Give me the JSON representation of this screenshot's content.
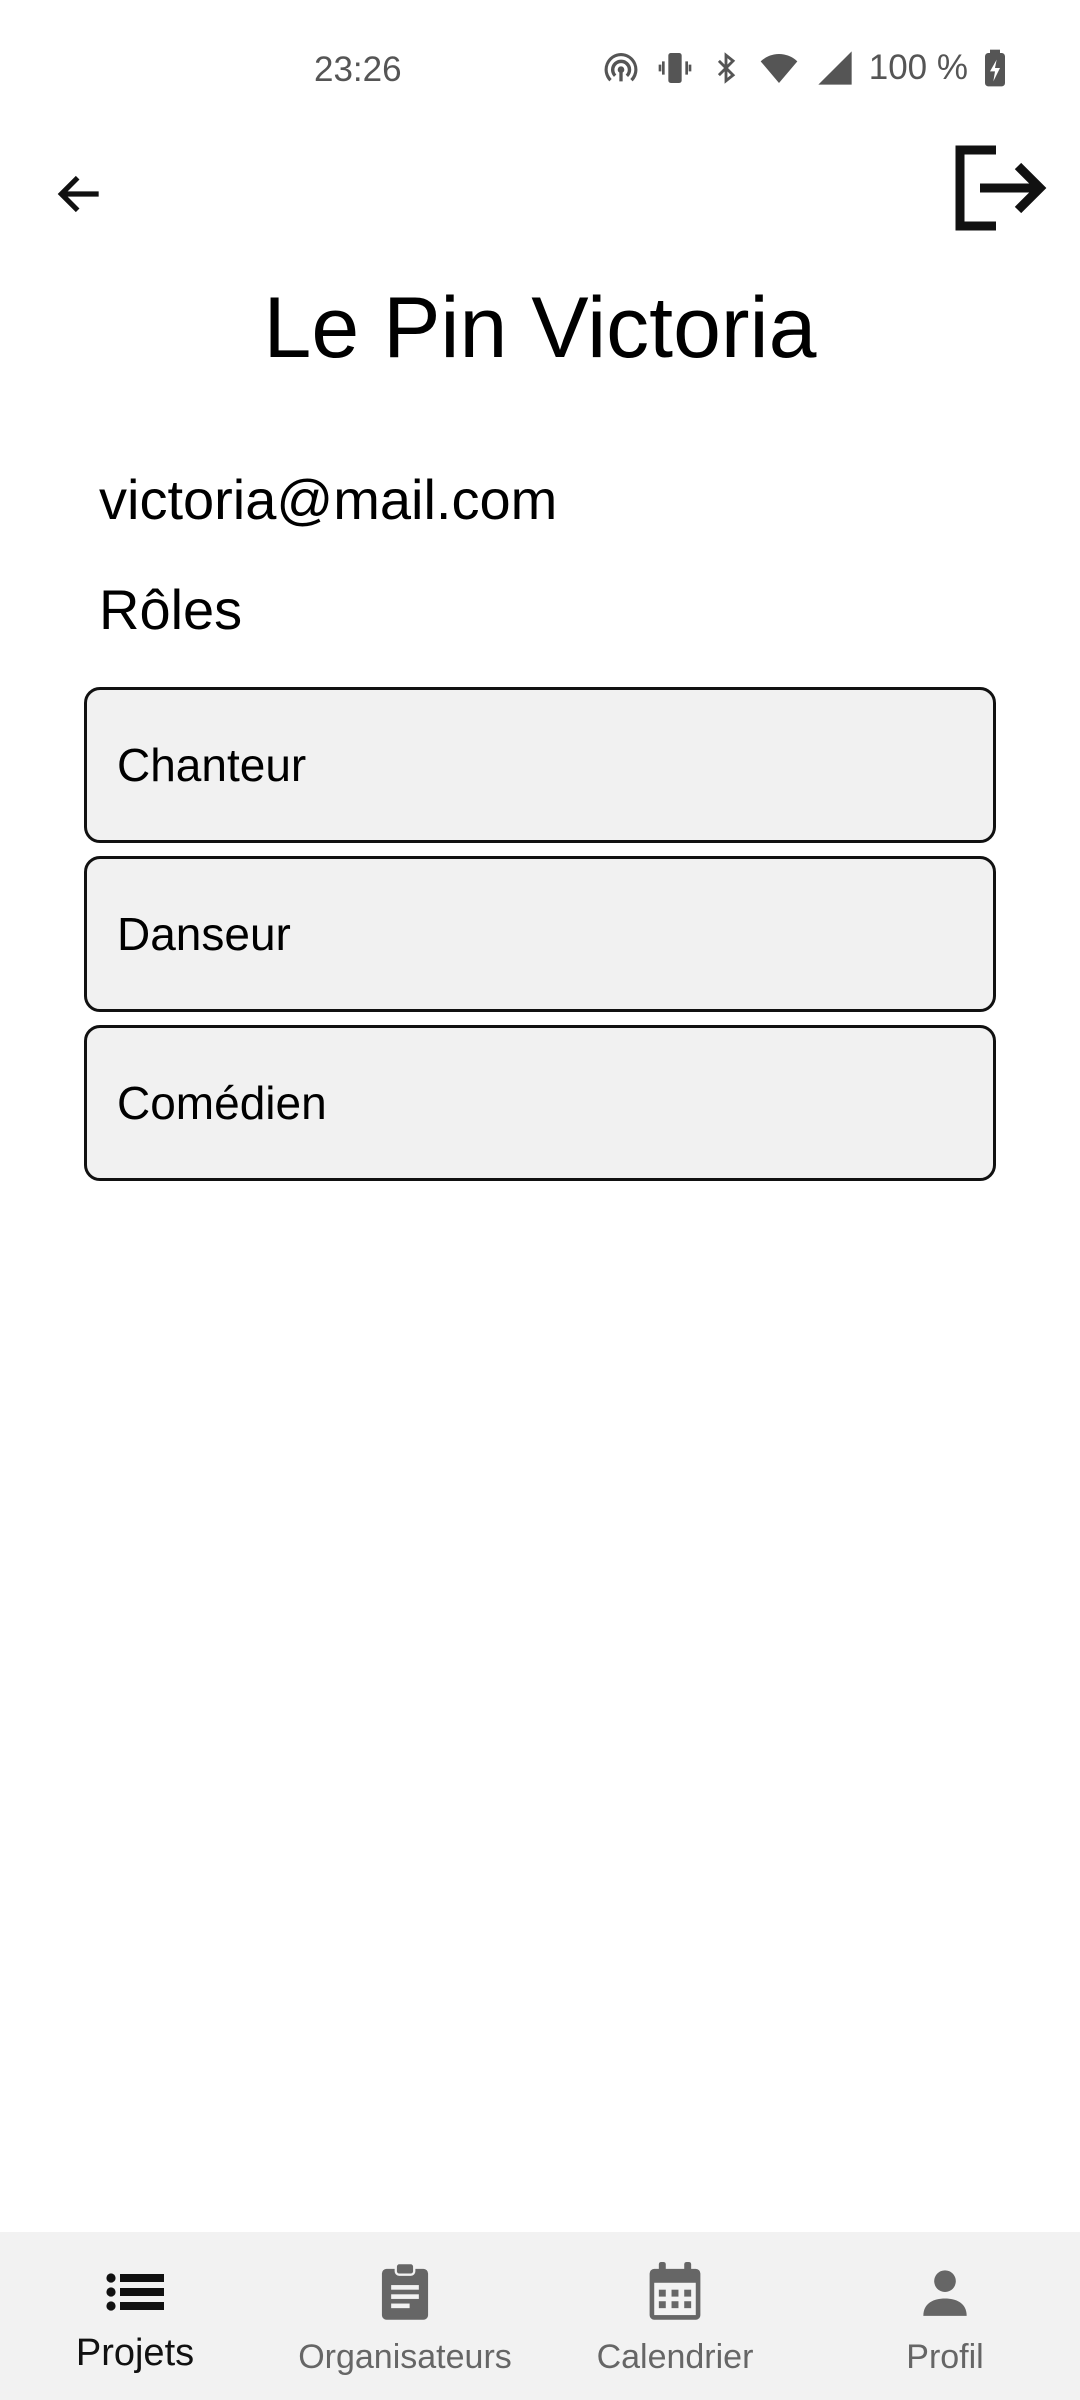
{
  "status_bar": {
    "time": "23:26",
    "battery": "100 %"
  },
  "profile": {
    "name": "Le Pin Victoria",
    "email": "victoria@mail.com",
    "roles_heading": "Rôles",
    "roles": [
      "Chanteur",
      "Danseur",
      "Comédien"
    ]
  },
  "bottom_nav": {
    "items": [
      {
        "label": "Projets",
        "icon": "list-icon",
        "active": true
      },
      {
        "label": "Organisateurs",
        "icon": "clipboard-icon",
        "active": false
      },
      {
        "label": "Calendrier",
        "icon": "calendar-icon",
        "active": false
      },
      {
        "label": "Profil",
        "icon": "person-icon",
        "active": false
      }
    ]
  },
  "colors": {
    "nav_background": "#f2f2f2",
    "role_background": "#f1f1f1",
    "inactive": "#666666"
  }
}
